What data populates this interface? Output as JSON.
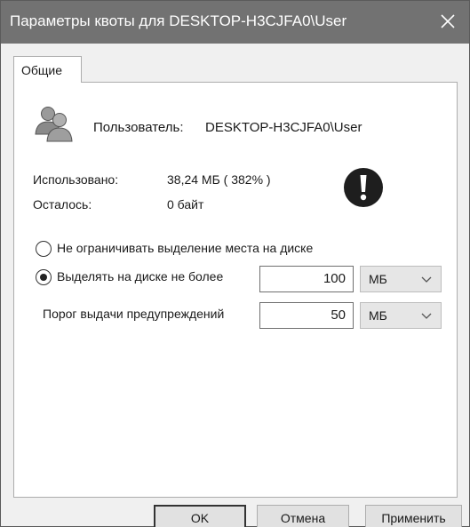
{
  "window": {
    "title": "Параметры квоты для DESKTOP-H3CJFA0\\User"
  },
  "tabs": [
    {
      "label": "Общие"
    }
  ],
  "user": {
    "label": "Пользователь:",
    "name": "DESKTOP-H3CJFA0\\User",
    "icon": "users-icon"
  },
  "usage": {
    "used_label": "Использовано:",
    "used_value": "38,24 МБ ( 382% )",
    "remaining_label": "Осталось:",
    "remaining_value": "0 байт",
    "status_icon": "exclamation-warning-icon"
  },
  "options": {
    "no_limit_label": "Не ограничивать выделение места на диске",
    "limit_label": "Выделять на диске не более",
    "limit_value": "100",
    "limit_unit": "МБ",
    "warning_label": "Порог выдачи предупреждений",
    "warning_value": "50",
    "warning_unit": "МБ",
    "selected": "limit"
  },
  "buttons": {
    "ok": "OK",
    "cancel": "Отмена",
    "apply": "Применить"
  },
  "colors": {
    "titlebar": "#727272",
    "warning_icon": "#1e1e1e"
  }
}
